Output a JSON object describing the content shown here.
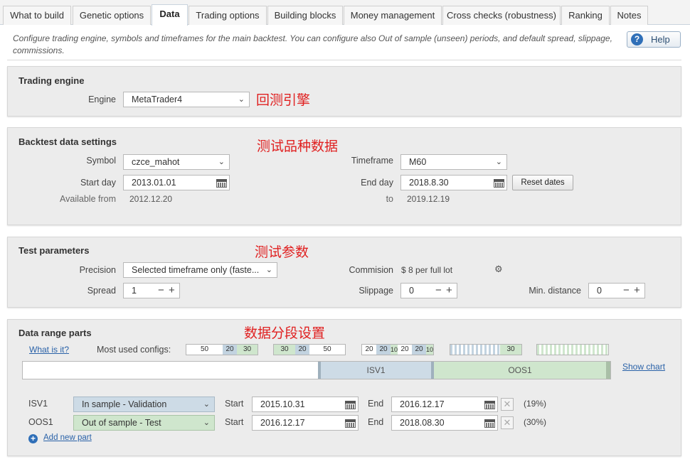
{
  "tabs": [
    {
      "label": "What to build",
      "active": false
    },
    {
      "label": "Genetic options",
      "active": false
    },
    {
      "label": "Data",
      "active": true
    },
    {
      "label": "Trading options",
      "active": false
    },
    {
      "label": "Building blocks",
      "active": false
    },
    {
      "label": "Money management",
      "active": false
    },
    {
      "label": "Cross checks (robustness)",
      "active": false
    },
    {
      "label": "Ranking",
      "active": false
    },
    {
      "label": "Notes",
      "active": false
    }
  ],
  "description": "Configure trading engine, symbols and timeframes for the main backtest. You can configure also Out of sample (unseen) periods, and default spread, slippage, commissions.",
  "help_label": "Help",
  "trading_engine": {
    "title": "Trading engine",
    "engine_label": "Engine",
    "engine_value": "MetaTrader4",
    "annotation": "回测引擎"
  },
  "backtest": {
    "title": "Backtest data settings",
    "annotation": "测试品种数据",
    "symbol_label": "Symbol",
    "symbol_value": "czce_mahot",
    "timeframe_label": "Timeframe",
    "timeframe_value": "M60",
    "start_label": "Start day",
    "start_value": "2013.01.01",
    "end_label": "End day",
    "end_value": "2018.8.30",
    "reset_label": "Reset dates",
    "available_label": "Available from",
    "available_value": "2012.12.20",
    "to_label": "to",
    "to_value": "2019.12.19"
  },
  "test_params": {
    "title": "Test parameters",
    "annotation": "测试参数",
    "precision_label": "Precision",
    "precision_value": "Selected timeframe only (faste...",
    "commission_label": "Commision",
    "commission_value": "$ 8 per full lot",
    "spread_label": "Spread",
    "spread_value": "1",
    "slippage_label": "Slippage",
    "slippage_value": "0",
    "min_distance_label": "Min. distance",
    "min_distance_value": "0"
  },
  "data_range": {
    "title": "Data range parts",
    "annotation": "数据分段设置",
    "what_link": "What is it?",
    "most_used_label": "Most used configs:",
    "configs": [
      [
        "50",
        "20",
        "30"
      ],
      [
        "30",
        "20",
        "50"
      ],
      [
        "20",
        "20",
        "10",
        "20",
        "20",
        "10"
      ],
      [
        "30"
      ]
    ],
    "bar_isv_label": "ISV1",
    "bar_oos_label": "OOS1",
    "show_chart": "Show chart",
    "parts": [
      {
        "name": "ISV1",
        "type": "In sample - Validation",
        "start_label": "Start",
        "start": "2015.10.31",
        "end_label": "End",
        "end": "2016.12.17",
        "pct": "(19%)"
      },
      {
        "name": "OOS1",
        "type": "Out of sample - Test",
        "start_label": "Start",
        "start": "2016.12.17",
        "end_label": "End",
        "end": "2018.08.30",
        "pct": "(30%)"
      }
    ],
    "add_part": "Add new part"
  },
  "colors": {
    "annotation_red": "#e02020",
    "validation_blue": "#cddbe6",
    "oos_green": "#cfe6cd",
    "link_blue": "#2a62a8"
  }
}
